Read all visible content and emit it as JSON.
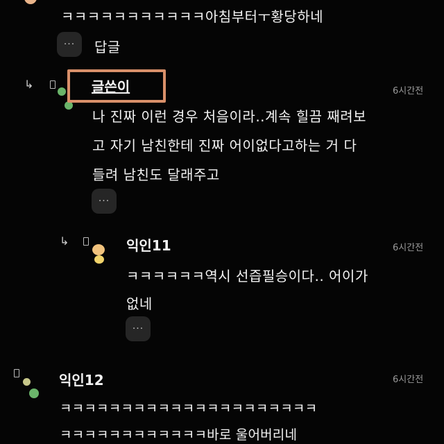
{
  "comment_top": {
    "text": "ㅋㅋㅋㅋㅋㅋㅋㅋㅋㅋㅋ아침부터ㅜ황당하네",
    "reply_label": "답글",
    "more_label": "···"
  },
  "reply_author": {
    "name": "글쓴이",
    "time": "6시간전",
    "lines": [
      "나 진짜 이런 경우 처음이라..계속 힐끔 째려보",
      "고 자기 남친한테 진짜 어이없다고하는 거 다",
      "들려 남친도 달래주고"
    ],
    "more_label": "···"
  },
  "reply_11": {
    "name": "익인11",
    "time": "6시간전",
    "lines": [
      "ㅋㅋㅋㅋㅋㅋ역시 선즙필승이다.. 어이가",
      "없네"
    ],
    "more_label": "···"
  },
  "comment_12": {
    "name": "익인12",
    "time": "6시간전",
    "lines": [
      "ㅋㅋㅋㅋㅋㅋㅋㅋㅋㅋㅋㅋㅋㅋㅋㅋㅋㅋㅋㅋㅋ",
      "ㅋㅋㅋㅋㅋㅋㅋㅋㅋㅋㅋㅋ바로 울어버리네"
    ]
  },
  "colors": {
    "background": "#050505",
    "highlight_box": "#d9906a",
    "avatar_green": "#6ab46a",
    "avatar_peach": "#f1c27d",
    "avatar_yellow": "#f1d36b"
  },
  "icons": {
    "reply_arrow": "reply-arrow-icon",
    "more": "more-dots-icon",
    "phone": "phone-icon"
  }
}
